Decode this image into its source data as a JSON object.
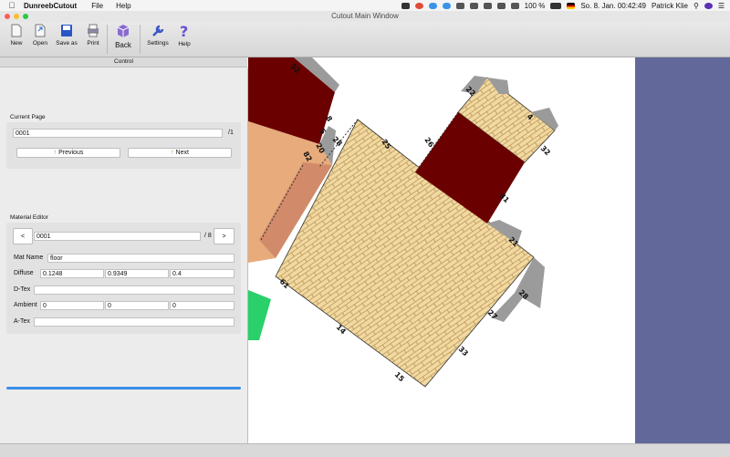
{
  "menubar": {
    "app_name": "DunreebCutout",
    "menus": [
      "File",
      "Help"
    ],
    "battery": "100 %",
    "datetime": "So. 8. Jan.  00:42:49",
    "user": "Patrick Klie"
  },
  "window": {
    "title": "Cutout Main Window"
  },
  "toolbar": {
    "new_label": "New",
    "open_label": "Open",
    "save_as_label": "Save as",
    "print_label": "Print",
    "back_label": "Back",
    "settings_label": "Settings",
    "help_label": "Help"
  },
  "control": {
    "title": "Control",
    "current_page": {
      "label": "Current Page",
      "value": "0001",
      "total": "/1",
      "previous_label": "Previous",
      "next_label": "Next"
    },
    "material_editor": {
      "label": "Material Editor",
      "prev_label": "<",
      "next_label": ">",
      "index_value": "0001",
      "total": "/ 8",
      "mat_name_label": "Mat Name",
      "mat_name_value": "floor",
      "diffuse_label": "Diffuse",
      "diffuse": [
        "0.1248",
        "0.9349",
        "0.4"
      ],
      "dtex_label": "D-Tex",
      "dtex_value": "",
      "ambient_label": "Ambient",
      "ambient": [
        "0",
        "0",
        "0"
      ],
      "atex_label": "A-Tex",
      "atex_value": ""
    }
  },
  "canvas": {
    "edge_labels": [
      "52",
      "8",
      "5",
      "20",
      "28",
      "25",
      "26",
      "22",
      "4",
      "32",
      "31",
      "21",
      "33",
      "27",
      "28",
      "14",
      "15",
      "61",
      "82"
    ],
    "colors": {
      "brick": "#f1d9a0",
      "brick_line": "#b9935a",
      "dark_red": "#6b0000",
      "tan": "#e7ab7c",
      "tab_grey": "#9b9b9b",
      "green": "#2ad06a"
    }
  }
}
